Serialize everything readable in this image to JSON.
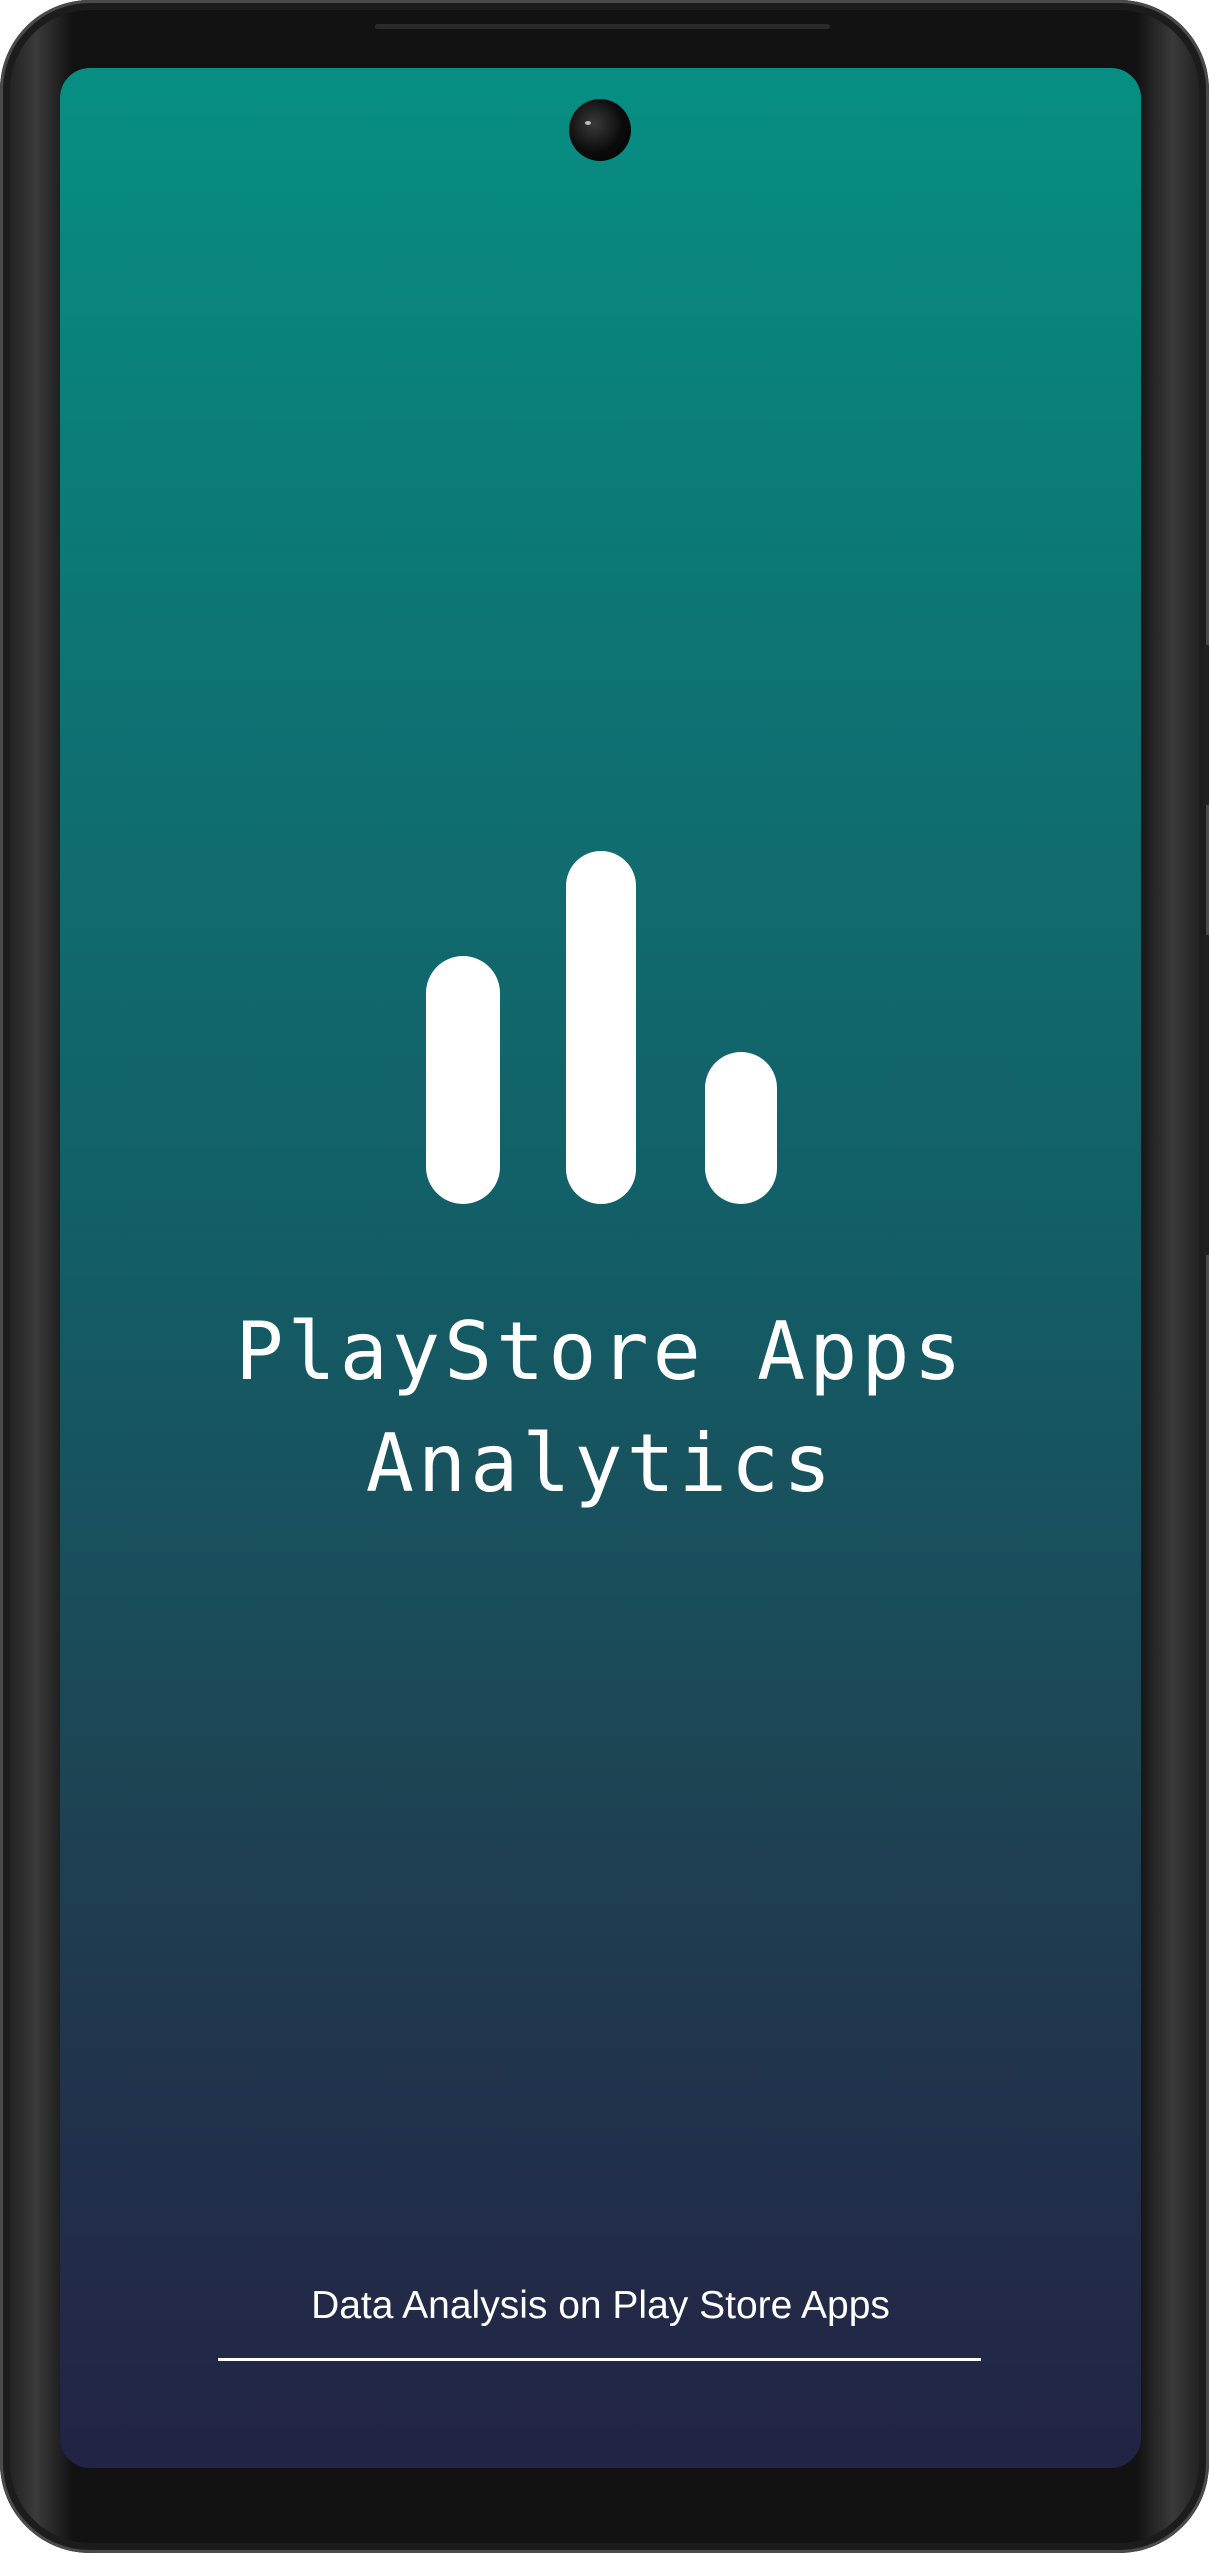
{
  "splash": {
    "title_line1": "PlayStore Apps",
    "title_line2": "Analytics",
    "tagline": "Data Analysis on Play Store Apps"
  },
  "logo": {
    "icon": "bar-chart-icon"
  },
  "colors": {
    "gradient_top": "#078f83",
    "gradient_bottom": "#222345",
    "text": "#ffffff"
  }
}
